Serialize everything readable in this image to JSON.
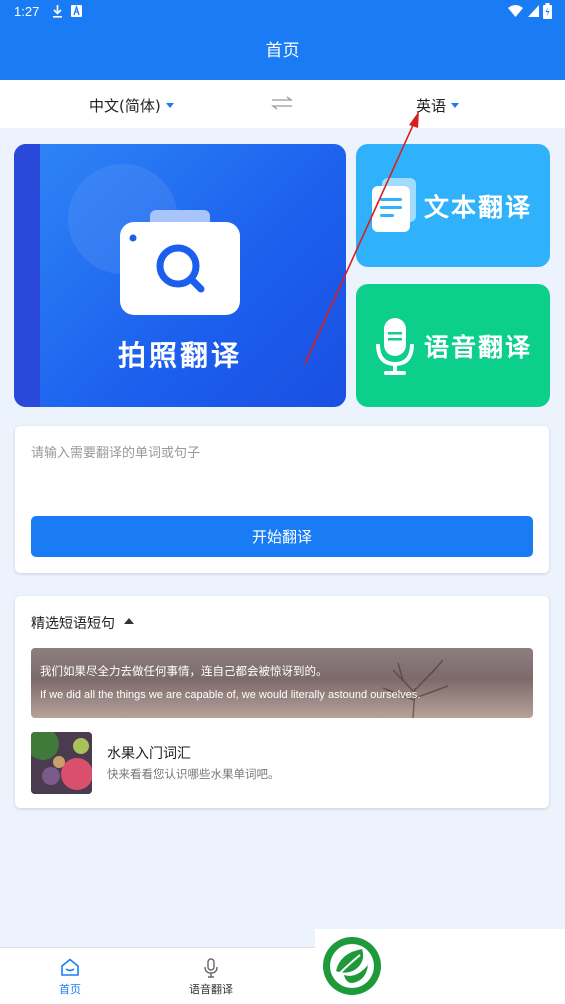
{
  "status_bar": {
    "time": "1:27"
  },
  "header": {
    "title": "首页"
  },
  "languages": {
    "source": "中文(简体)",
    "target": "英语"
  },
  "feature_cards": {
    "photo": "拍照翻译",
    "text": "文本翻译",
    "voice": "语音翻译"
  },
  "input": {
    "placeholder": "请输入需要翻译的单词或句子",
    "button": "开始翻译"
  },
  "phrases": {
    "title": "精选短语短句",
    "quote_cn": "我们如果尽全力去做任何事情，连自己都会被惊讶到的。",
    "quote_en": "If we did all the things we are capable of, we would literally astound ourselves.",
    "item_title": "水果入门词汇",
    "item_subtitle": "快来看看您认识哪些水果单词吧。"
  },
  "nav": {
    "home": "首页",
    "voice": "语音翻译"
  },
  "colors": {
    "primary": "#1a7cf5",
    "text_card": "#2fb2fb",
    "voice_card": "#0dcf8c",
    "background": "#edf3fd",
    "annotation_arrow": "#d62020"
  }
}
